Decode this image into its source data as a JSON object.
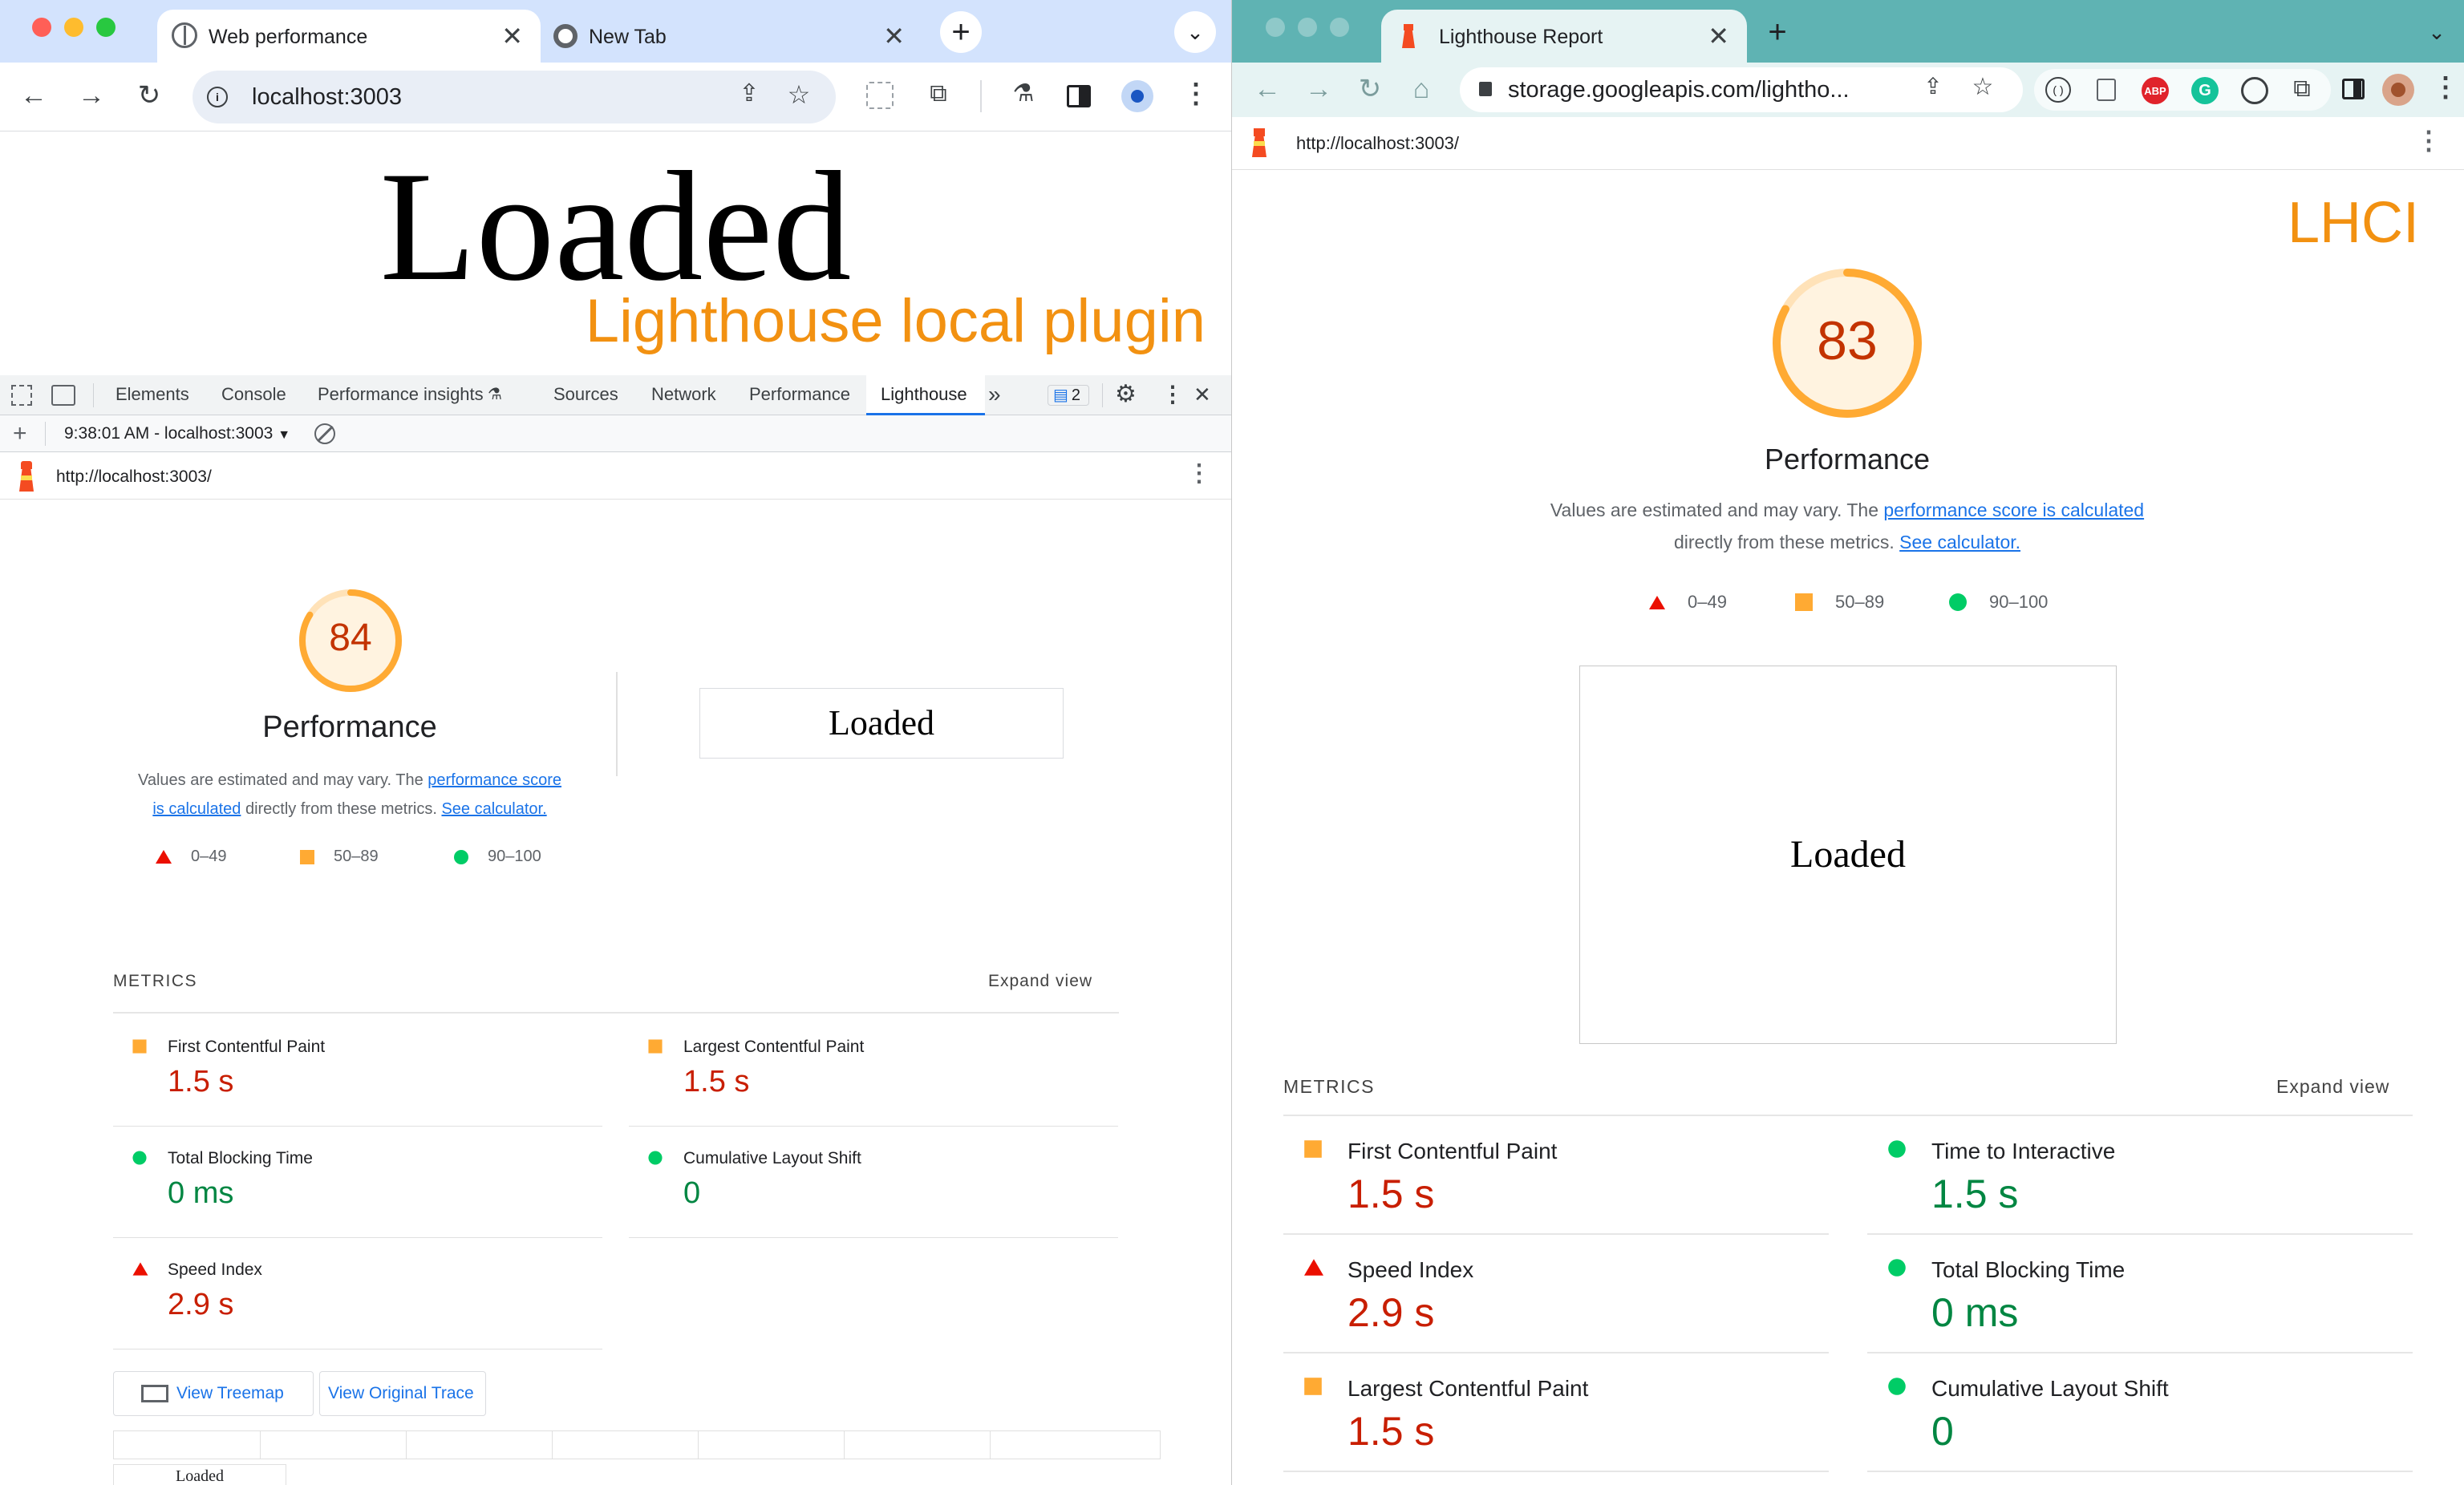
{
  "left": {
    "tabs": [
      {
        "title": "Web performance"
      },
      {
        "title": "New Tab"
      }
    ],
    "address": "localhost:3003",
    "page": {
      "heading": "Loaded",
      "overlay": "Lighthouse local plugin"
    },
    "devtools": {
      "tabs": [
        "Elements",
        "Console",
        "Performance insights",
        "Sources",
        "Network",
        "Performance",
        "Lighthouse"
      ],
      "issues_count": "2",
      "session": "9:38:01 AM - localhost:3003",
      "report_url": "http://localhost:3003/"
    },
    "report": {
      "score": "84",
      "category": "Performance",
      "desc_prefix": "Values are estimated and may vary. The",
      "desc_link1a": "performance score",
      "desc_link1b": "is calculated",
      "desc_mid": "directly from these metrics.",
      "desc_link2": "See calculator.",
      "legend": [
        "0–49",
        "50–89",
        "90–100"
      ],
      "screenshot_text": "Loaded",
      "metrics_title": "METRICS",
      "expand": "Expand view",
      "metrics": [
        {
          "name": "First Contentful Paint",
          "value": "1.5 s",
          "rating": "average"
        },
        {
          "name": "Largest Contentful Paint",
          "value": "1.5 s",
          "rating": "average"
        },
        {
          "name": "Total Blocking Time",
          "value": "0 ms",
          "rating": "pass"
        },
        {
          "name": "Cumulative Layout Shift",
          "value": "0",
          "rating": "pass"
        },
        {
          "name": "Speed Index",
          "value": "2.9 s",
          "rating": "fail"
        }
      ],
      "btn_treemap": "View Treemap",
      "btn_trace": "View Original Trace",
      "filmstrip_text": "Loaded"
    }
  },
  "right": {
    "tabs": [
      {
        "title": "Lighthouse Report"
      }
    ],
    "address": "storage.googleapis.com/lightho...",
    "report_url": "http://localhost:3003/",
    "overlay": "LHCI",
    "report": {
      "score": "83",
      "category": "Performance",
      "desc_prefix": "Values are estimated and may vary. The",
      "desc_link1": "performance score is calculated",
      "desc_mid": "directly from these metrics.",
      "desc_link2": "See calculator.",
      "legend": [
        "0–49",
        "50–89",
        "90–100"
      ],
      "screenshot_text": "Loaded",
      "metrics_title": "METRICS",
      "expand": "Expand view",
      "metrics": [
        {
          "name": "First Contentful Paint",
          "value": "1.5 s",
          "rating": "average"
        },
        {
          "name": "Time to Interactive",
          "value": "1.5 s",
          "rating": "pass"
        },
        {
          "name": "Speed Index",
          "value": "2.9 s",
          "rating": "fail"
        },
        {
          "name": "Total Blocking Time",
          "value": "0 ms",
          "rating": "pass"
        },
        {
          "name": "Largest Contentful Paint",
          "value": "1.5 s",
          "rating": "average"
        },
        {
          "name": "Cumulative Layout Shift",
          "value": "0",
          "rating": "pass"
        }
      ]
    },
    "extensions": [
      "ABP"
    ]
  },
  "colors": {
    "left_chrome": "#d3e3fd",
    "right_chrome": "#5fb3b3",
    "orange_overlay": "#f29111",
    "score_orange": "#fa3",
    "score_text": "#c33300",
    "fail": "#eb0f00",
    "pass": "#0c6"
  }
}
